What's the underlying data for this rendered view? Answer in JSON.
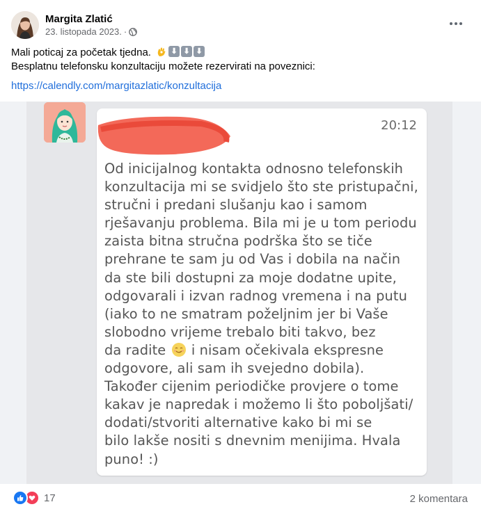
{
  "post": {
    "author": "Margita Zlatić",
    "date": "23. listopada 2023.",
    "separator": "·",
    "privacy_icon": "globe-icon",
    "more_icon": "more-options-icon",
    "text_line1": "Mali poticaj za početak tjedna.",
    "text_line1_emojis": [
      "ok-hand-icon",
      "down-arrow-icon",
      "down-arrow-icon",
      "down-arrow-icon"
    ],
    "text_line2": "Besplatnu telefonsku konzultaciju možete rezervirati na poveznici:",
    "link": "https://calendly.com/margitazlatic/konzultacija"
  },
  "screenshot_message": {
    "time": "20:12",
    "redacted": true,
    "lines": [
      "Od inicijalnog kontakta odnosno telefonskih",
      "konzultacija mi se svidjelo što ste pristupačni,",
      "stručni i predani slušanju kao i samom",
      "rješavanju problema. Bila mi je u tom periodu",
      "zaista bitna stručna podrška što se tiče",
      "prehrane te sam ju od Vas i dobila na način",
      "da ste bili dostupni za moje dodatne upite,",
      "odgovarali i izvan radnog vremena i na putu",
      "(iako to ne smatram poželjnim jer bi Vaše",
      "slobodno vrijeme trebalo biti takvo, bez"
    ],
    "line11_before": "da radite",
    "line11_after": "i nisam očekivala ekspresne",
    "lines_after": [
      "odgovore, ali sam ih svejedno dobila).",
      "Također cijenim periodičke provjere o tome",
      "kakav je napredak i možemo li što poboljšati/",
      "dodati/stvoriti alternative kako bi mi se",
      "bilo lakše nositi s dnevnim menijima. Hvala",
      "puno! :)"
    ]
  },
  "footer": {
    "reaction_icons": [
      "like-icon",
      "love-icon"
    ],
    "reaction_count": "17",
    "comments": "2 komentara"
  },
  "colors": {
    "link": "#216fdb",
    "like": "#1877f2",
    "love": "#f33e58",
    "redaction": "#f25c4b"
  }
}
